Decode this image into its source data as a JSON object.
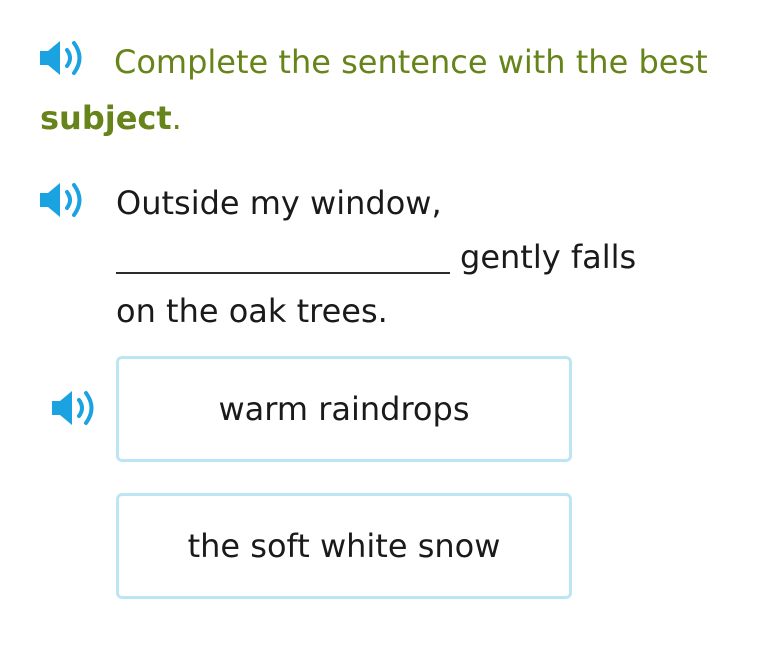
{
  "instruction": {
    "lead": "Complete the sentence with the best",
    "keyword": "subject",
    "end": "."
  },
  "sentence": {
    "line1": "Outside my window,",
    "after_blank": "gently falls",
    "line3": "on the oak trees."
  },
  "choices": [
    {
      "label": "warm raindrops"
    },
    {
      "label": "the soft white snow"
    }
  ],
  "icons": {
    "speaker": "speaker-icon"
  },
  "colors": {
    "instruction_green": "#66841a",
    "speaker_blue": "#1aa3e0",
    "choice_border": "#bde6f5",
    "text": "#1a1a1a"
  }
}
